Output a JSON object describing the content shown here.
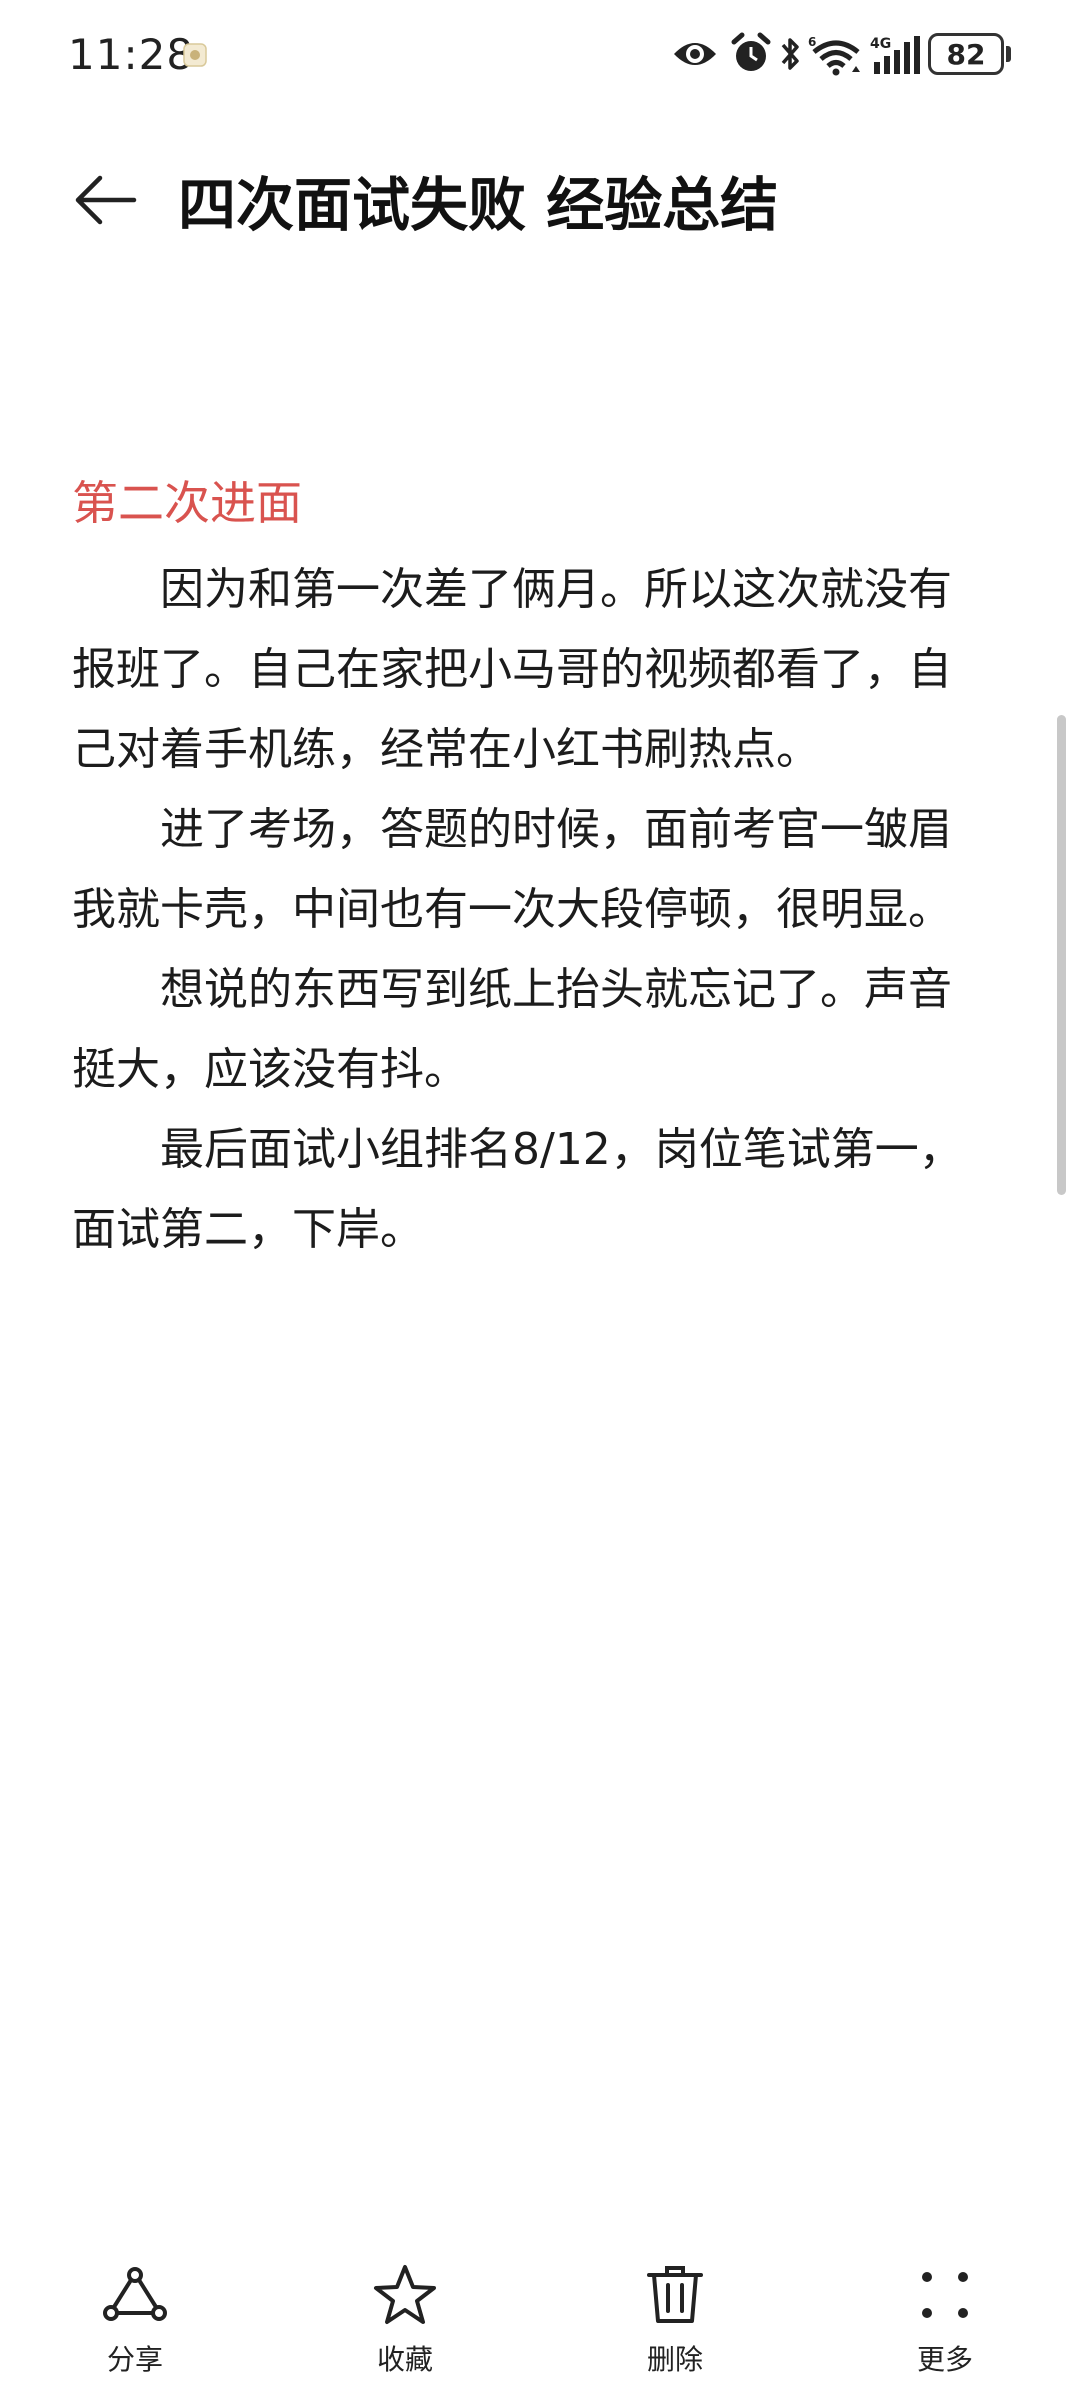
{
  "status_bar": {
    "time": "11:28",
    "battery": "82",
    "icons": [
      "notification-icon",
      "eye-icon",
      "alarm-icon",
      "bluetooth-icon",
      "wifi-icon",
      "signal-icon",
      "battery-icon"
    ],
    "network_label": "4G",
    "wifi_label": "6"
  },
  "header": {
    "title": "四次面试失败 经验总结"
  },
  "content": {
    "section_heading": "第二次进面",
    "paragraphs": [
      "因为和第一次差了俩月。所以这次就没有报班了。自己在家把小马哥的视频都看了，自己对着手机练，经常在小红书刷热点。",
      "进了考场，答题的时候，面前考官一皱眉我就卡壳，中间也有一次大段停顿，很明显。",
      "想说的东西写到纸上抬头就忘记了。声音挺大，应该没有抖。",
      "最后面试小组排名8/12，岗位笔试第一，面试第二，下岸。"
    ]
  },
  "toolbar": {
    "share_label": "分享",
    "favorite_label": "收藏",
    "delete_label": "删除",
    "more_label": "更多"
  },
  "colors": {
    "heading_red": "#d9534f",
    "text": "#1c1c1c",
    "scrollbar": "#c8c8c8"
  }
}
